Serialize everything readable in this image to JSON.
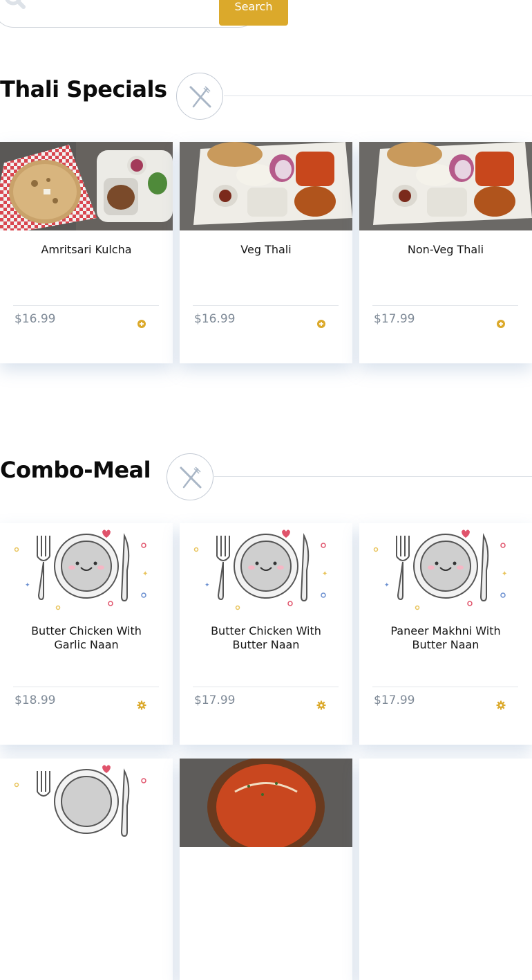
{
  "search": {
    "placeholder": "",
    "button_label": "Search"
  },
  "sections": [
    {
      "title": "Thali Specials",
      "items": [
        {
          "name": "Amritsari Kulcha",
          "price": "$16.99",
          "image": "kulcha-photo"
        },
        {
          "name": "Veg Thali",
          "price": "$16.99",
          "image": "thali-photo"
        },
        {
          "name": "Non-Veg Thali",
          "price": "$17.99",
          "image": "thali-photo"
        }
      ]
    },
    {
      "title": "Combo-Meal",
      "items": [
        {
          "name": "Butter Chicken With Garlic Naan",
          "price": "$18.99",
          "image": "plate-illustration"
        },
        {
          "name": "Butter Chicken With Butter Naan",
          "price": "$17.99",
          "image": "plate-illustration"
        },
        {
          "name": "Paneer Makhni With Butter Naan",
          "price": "$17.99",
          "image": "plate-illustration"
        },
        {
          "name": "",
          "price": "",
          "image": "plate-illustration"
        },
        {
          "name": "",
          "price": "",
          "image": "curry-photo"
        }
      ]
    }
  ],
  "colors": {
    "accent": "#dba92b",
    "price_text": "#7f8a97",
    "badge_border": "#c3cad4",
    "card_shadow": "#c8d6e6"
  },
  "icons": {
    "search": "search-icon",
    "section_badge": "cutlery-icon",
    "thali_add": "plus-circle-icon",
    "combo_add": "gear-icon"
  }
}
